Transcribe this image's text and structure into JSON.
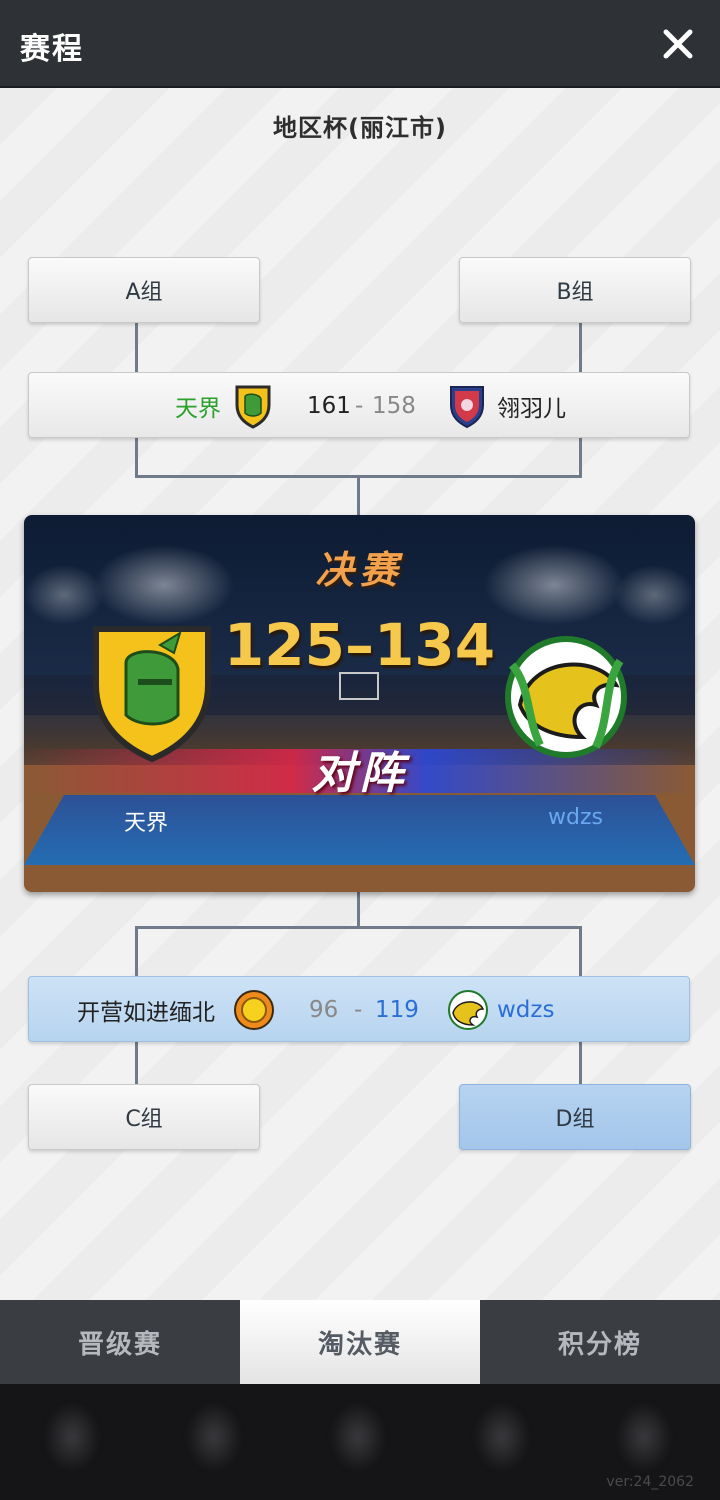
{
  "header": {
    "title": "赛程",
    "close_icon": "close-icon"
  },
  "cup_title": "地区杯(丽江市)",
  "groups": {
    "a": "A组",
    "b": "B组",
    "c": "C组",
    "d": "D组"
  },
  "semi_top": {
    "team_left": "天界",
    "score_left": "161",
    "separator": "-",
    "score_right": "158",
    "team_right": "翎羽儿",
    "left_color": "#2aa12a",
    "winner": "left"
  },
  "final": {
    "label": "决赛",
    "score_left": "125",
    "dash": "–",
    "score_right": "134",
    "vs_label": "对阵",
    "team_left": "天界",
    "team_right": "wdzs",
    "winner": "right"
  },
  "semi_bottom": {
    "team_left": "开营如进缅北",
    "score_left": "96",
    "separator": "-",
    "score_right": "119",
    "team_right": "wdzs",
    "right_color": "#2b6fd6",
    "winner": "right"
  },
  "tabs": [
    {
      "label": "晋级赛",
      "active": false
    },
    {
      "label": "淘汰赛",
      "active": true
    },
    {
      "label": "积分榜",
      "active": false
    }
  ],
  "version": "ver:24_2062"
}
